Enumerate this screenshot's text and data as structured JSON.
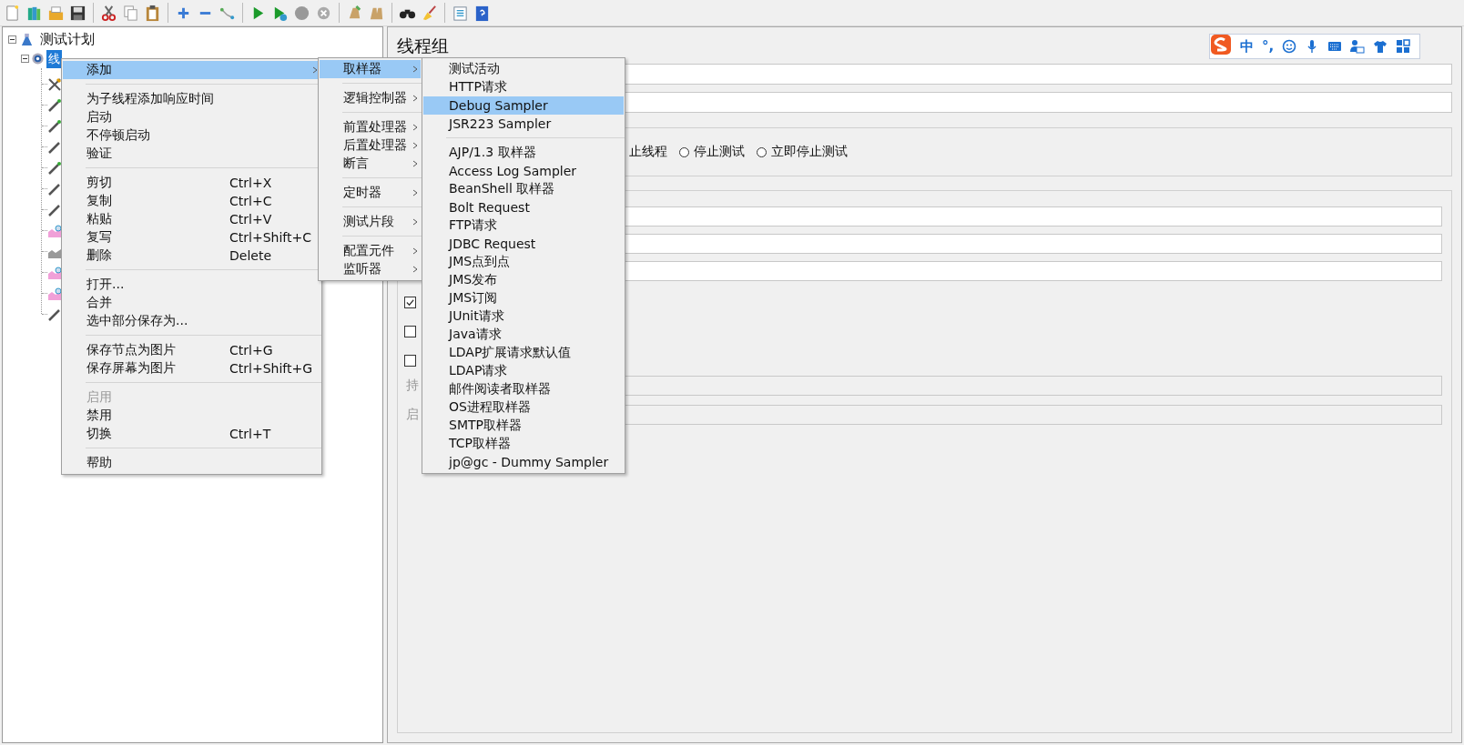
{
  "tree": {
    "items": [
      {
        "label": "测试计划",
        "expanded": true,
        "selected": false,
        "children": [
          {
            "label": "线",
            "expanded": true,
            "selected": true
          }
        ]
      }
    ]
  },
  "panel": {
    "title": "线程组",
    "error_action": {
      "partial_label": "止线程",
      "options": [
        {
          "label": "停止测试",
          "selected": false
        },
        {
          "label": "立即停止测试",
          "selected": false
        }
      ]
    },
    "checkboxes": [
      {
        "checked": true
      },
      {
        "checked": false
      },
      {
        "checked": false
      }
    ],
    "disabled_fields": [
      {
        "label": "持",
        "disabled": true
      },
      {
        "label": "启",
        "disabled": true
      }
    ]
  },
  "ime_bar": {
    "mode": "中",
    "punctuation": "°,"
  },
  "context_menu": {
    "groups": [
      [
        {
          "label": "添加",
          "submenu": true,
          "disabled": false,
          "selected": true
        }
      ],
      [
        {
          "label": "为子线程添加响应时间",
          "submenu": false,
          "disabled": false,
          "selected": false
        },
        {
          "label": "启动",
          "submenu": false,
          "disabled": false,
          "selected": false
        },
        {
          "label": "不停顿启动",
          "submenu": false,
          "disabled": false,
          "selected": false
        },
        {
          "label": "验证",
          "submenu": false,
          "disabled": false,
          "selected": false
        }
      ],
      [
        {
          "label": "剪切",
          "shortcut": "Ctrl+X",
          "submenu": false,
          "disabled": false,
          "selected": false
        },
        {
          "label": "复制",
          "shortcut": "Ctrl+C",
          "submenu": false,
          "disabled": false,
          "selected": false
        },
        {
          "label": "粘贴",
          "shortcut": "Ctrl+V",
          "submenu": false,
          "disabled": false,
          "selected": false
        },
        {
          "label": "复写",
          "shortcut": "Ctrl+Shift+C",
          "submenu": false,
          "disabled": false,
          "selected": false
        },
        {
          "label": "删除",
          "shortcut": "Delete",
          "submenu": false,
          "disabled": false,
          "selected": false
        }
      ],
      [
        {
          "label": "打开...",
          "submenu": false,
          "disabled": false,
          "selected": false
        },
        {
          "label": "合并",
          "submenu": false,
          "disabled": false,
          "selected": false
        },
        {
          "label": "选中部分保存为...",
          "submenu": false,
          "disabled": false,
          "selected": false
        }
      ],
      [
        {
          "label": "保存节点为图片",
          "shortcut": "Ctrl+G",
          "submenu": false,
          "disabled": false,
          "selected": false
        },
        {
          "label": "保存屏幕为图片",
          "shortcut": "Ctrl+Shift+G",
          "submenu": false,
          "disabled": false,
          "selected": false
        }
      ],
      [
        {
          "label": "启用",
          "submenu": false,
          "disabled": true,
          "selected": false
        },
        {
          "label": "禁用",
          "submenu": false,
          "disabled": false,
          "selected": false
        },
        {
          "label": "切换",
          "shortcut": "Ctrl+T",
          "submenu": false,
          "disabled": false,
          "selected": false
        }
      ],
      [
        {
          "label": "帮助",
          "submenu": false,
          "disabled": false,
          "selected": false
        }
      ]
    ]
  },
  "add_menu": {
    "groups": [
      [
        {
          "label": "取样器",
          "submenu": true,
          "disabled": false,
          "selected": true
        }
      ],
      [
        {
          "label": "逻辑控制器",
          "submenu": true,
          "disabled": false,
          "selected": false
        }
      ],
      [
        {
          "label": "前置处理器",
          "submenu": true,
          "disabled": false,
          "selected": false
        },
        {
          "label": "后置处理器",
          "submenu": true,
          "disabled": false,
          "selected": false
        },
        {
          "label": "断言",
          "submenu": true,
          "disabled": false,
          "selected": false
        }
      ],
      [
        {
          "label": "定时器",
          "submenu": true,
          "disabled": false,
          "selected": false
        }
      ],
      [
        {
          "label": "测试片段",
          "submenu": true,
          "disabled": false,
          "selected": false
        }
      ],
      [
        {
          "label": "配置元件",
          "submenu": true,
          "disabled": false,
          "selected": false
        },
        {
          "label": "监听器",
          "submenu": true,
          "disabled": false,
          "selected": false
        }
      ]
    ]
  },
  "sampler_menu": {
    "groups": [
      [
        {
          "label": "测试活动",
          "submenu": false,
          "disabled": false,
          "selected": false
        },
        {
          "label": "HTTP请求",
          "submenu": false,
          "disabled": false,
          "selected": false
        },
        {
          "label": "Debug Sampler",
          "submenu": false,
          "disabled": false,
          "selected": true
        },
        {
          "label": "JSR223 Sampler",
          "submenu": false,
          "disabled": false,
          "selected": false
        }
      ],
      [
        {
          "label": "AJP/1.3 取样器",
          "submenu": false,
          "disabled": false,
          "selected": false
        },
        {
          "label": "Access Log Sampler",
          "submenu": false,
          "disabled": false,
          "selected": false
        },
        {
          "label": "BeanShell 取样器",
          "submenu": false,
          "disabled": false,
          "selected": false
        },
        {
          "label": "Bolt Request",
          "submenu": false,
          "disabled": false,
          "selected": false
        },
        {
          "label": "FTP请求",
          "submenu": false,
          "disabled": false,
          "selected": false
        },
        {
          "label": "JDBC Request",
          "submenu": false,
          "disabled": false,
          "selected": false
        },
        {
          "label": "JMS点到点",
          "submenu": false,
          "disabled": false,
          "selected": false
        },
        {
          "label": "JMS发布",
          "submenu": false,
          "disabled": false,
          "selected": false
        },
        {
          "label": "JMS订阅",
          "submenu": false,
          "disabled": false,
          "selected": false
        },
        {
          "label": "JUnit请求",
          "submenu": false,
          "disabled": false,
          "selected": false
        },
        {
          "label": "Java请求",
          "submenu": false,
          "disabled": false,
          "selected": false
        },
        {
          "label": "LDAP扩展请求默认值",
          "submenu": false,
          "disabled": false,
          "selected": false
        },
        {
          "label": "LDAP请求",
          "submenu": false,
          "disabled": false,
          "selected": false
        },
        {
          "label": "邮件阅读者取样器",
          "submenu": false,
          "disabled": false,
          "selected": false
        },
        {
          "label": "OS进程取样器",
          "submenu": false,
          "disabled": false,
          "selected": false
        },
        {
          "label": "SMTP取样器",
          "submenu": false,
          "disabled": false,
          "selected": false
        },
        {
          "label": "TCP取样器",
          "submenu": false,
          "disabled": false,
          "selected": false
        },
        {
          "label": "jp@gc - Dummy Sampler",
          "submenu": false,
          "disabled": false,
          "selected": false
        }
      ]
    ]
  }
}
